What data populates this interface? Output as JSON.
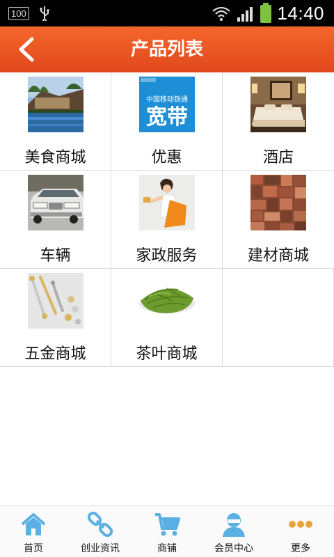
{
  "status_bar": {
    "battery_level": "100",
    "time": "14:40"
  },
  "header": {
    "title": "产品列表"
  },
  "grid": {
    "items": [
      {
        "label": "美食商城",
        "icon": "resort-pool-photo"
      },
      {
        "label": "优惠",
        "icon": "broadband-promo-image",
        "image_text": [
          "中国移动铁通",
          "宽带"
        ]
      },
      {
        "label": "酒店",
        "icon": "hotel-room-photo"
      },
      {
        "label": "车辆",
        "icon": "car-photo"
      },
      {
        "label": "家政服务",
        "icon": "cleaning-service-photo"
      },
      {
        "label": "建材商城",
        "icon": "building-materials-photo"
      },
      {
        "label": "五金商城",
        "icon": "hardware-handles-photo"
      },
      {
        "label": "茶叶商城",
        "icon": "tea-leaves-photo"
      }
    ]
  },
  "tabbar": {
    "tabs": [
      {
        "label": "首页",
        "icon": "home-icon"
      },
      {
        "label": "创业资讯",
        "icon": "link-icon"
      },
      {
        "label": "商铺",
        "icon": "cart-icon"
      },
      {
        "label": "会员中心",
        "icon": "user-icon"
      },
      {
        "label": "更多",
        "icon": "more-icon"
      }
    ]
  },
  "colors": {
    "header_top": "#f4672b",
    "header_bottom": "#e1471d",
    "tab_icon": "#5ab0e3",
    "more_dots": "#e8a43a"
  }
}
